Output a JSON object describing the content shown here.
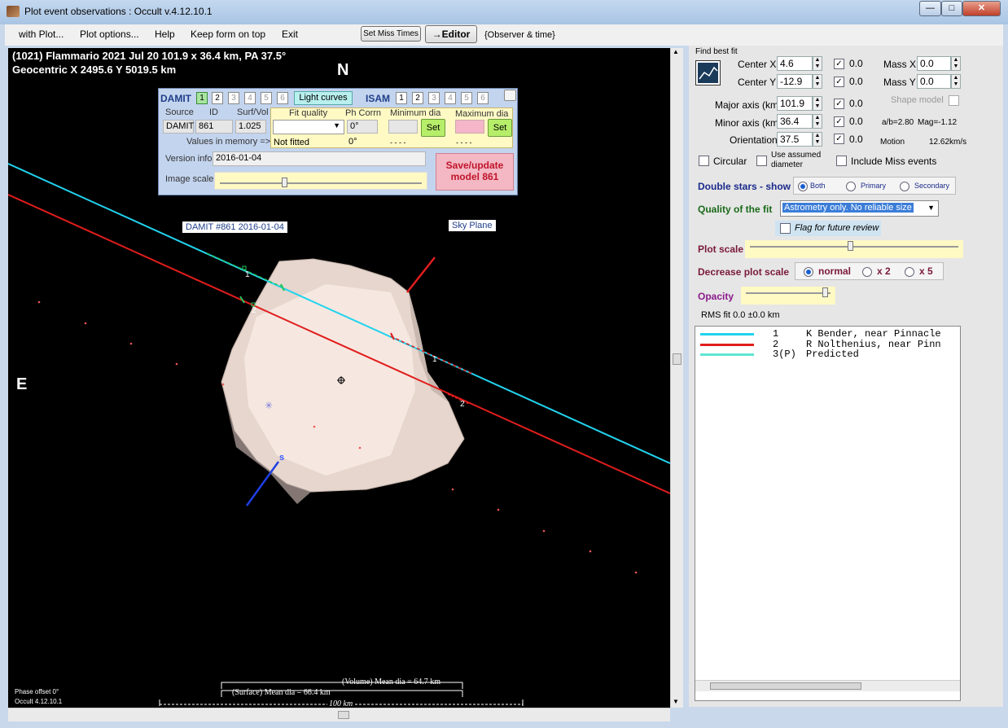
{
  "window": {
    "title": "Plot event observations : Occult v.4.12.10.1"
  },
  "menu": {
    "items": [
      "with Plot...",
      "Plot options...",
      "Help",
      "Keep form on top",
      "Exit"
    ],
    "set_miss_times": "Set Miss Times",
    "editor": "→Editor",
    "observer_time": "{Observer & time}"
  },
  "plot": {
    "header_line1": "(1021) Flammario  2021 Jul 20   101.9 x 36.4 km, PA 37.5°",
    "header_line2": "Geocentric  X  2495.6  Y 5019.5 km",
    "north": "N",
    "east": "E",
    "damit_label": "DAMIT #861 2016-01-04",
    "sky_plane": "Sky Plane",
    "chord1": "1",
    "chord2": "2",
    "axis_south": "s",
    "volume_dia": "(Volume) Mean dia = 64.7 km",
    "surface_dia": "(Surface) Mean dia = 66.4 km",
    "scale_label": "100 km",
    "phase_offset": "Phase offset 0°",
    "version": "Occult 4.12.10.1"
  },
  "damit_panel": {
    "damit_title": "DAMIT",
    "damit_models": [
      "1",
      "2",
      "3",
      "4",
      "5",
      "6"
    ],
    "light_curves": "Light curves",
    "isam_title": "ISAM",
    "isam_models": [
      "1",
      "2",
      "3",
      "4",
      "5",
      "6"
    ],
    "col_source": "Source",
    "col_id": "ID",
    "col_surf_vol": "Surf/Vol",
    "col_fit_quality": "Fit quality",
    "col_ph_corrn": "Ph Corrn",
    "col_min_dia": "Minimum dia",
    "col_max_dia": "Maximum dia",
    "source": "DAMIT",
    "id": "861",
    "surf_vol": "1.025",
    "ph_corrn": "0°",
    "set_label": "Set",
    "values_in_memory": "Values in memory =>",
    "not_fitted": "Not fitted",
    "mem_ph": "0°",
    "mem_min": "- - - -",
    "mem_max": "- - - -",
    "version_info_label": "Version info",
    "version_info": "2016-01-04",
    "image_scale_label": "Image scale",
    "save_update": "Save/update model 861"
  },
  "fit_panel": {
    "find_best_fit": "Find best fit",
    "center_x_label": "Center X",
    "center_x": "4.6",
    "center_y_label": "Center Y",
    "center_y": "-12.9",
    "major_label": "Major axis (km)",
    "major": "101.9",
    "minor_label": "Minor axis (km)",
    "minor": "36.4",
    "orient_label": "Orientation",
    "orient": "37.5",
    "uncert_cx": "0.0",
    "uncert_cy": "0.0",
    "uncert_major": "0.0",
    "uncert_minor": "0.0",
    "uncert_orient": "0.0",
    "mass_x_label": "Mass X",
    "mass_x": "0.0",
    "mass_y_label": "Mass Y",
    "mass_y": "0.0",
    "shape_model": "Shape model",
    "ratio": "a/b=2.80",
    "mag": "Mag=-1.12",
    "motion_label": "Motion",
    "motion": "12.62km/s",
    "circular": "Circular",
    "use_assumed": "Use assumed diameter",
    "include_miss": "Include Miss events",
    "double_stars": "Double stars - show",
    "ds_both": "Both",
    "ds_primary": "Primary",
    "ds_secondary": "Secondary",
    "quality_label": "Quality of the fit",
    "quality_value": "Astrometry only. No reliable size",
    "flag_review": "Flag for future review",
    "plot_scale": "Plot scale",
    "decrease_scale": "Decrease plot scale",
    "dec_normal": "normal",
    "dec_x2": "x 2",
    "dec_x5": "x 5",
    "opacity": "Opacity",
    "rms_fit": "RMS fit 0.0 ±0.0 km"
  },
  "legend": [
    {
      "num": "1",
      "name": "K Bender, near Pinnacle",
      "color": "#22d3ee"
    },
    {
      "num": "2",
      "name": "R Nolthenius, near Pinn",
      "color": "#e11d1d"
    },
    {
      "num": "3(P)",
      "name": "Predicted",
      "color": "#5ee6d0"
    }
  ]
}
